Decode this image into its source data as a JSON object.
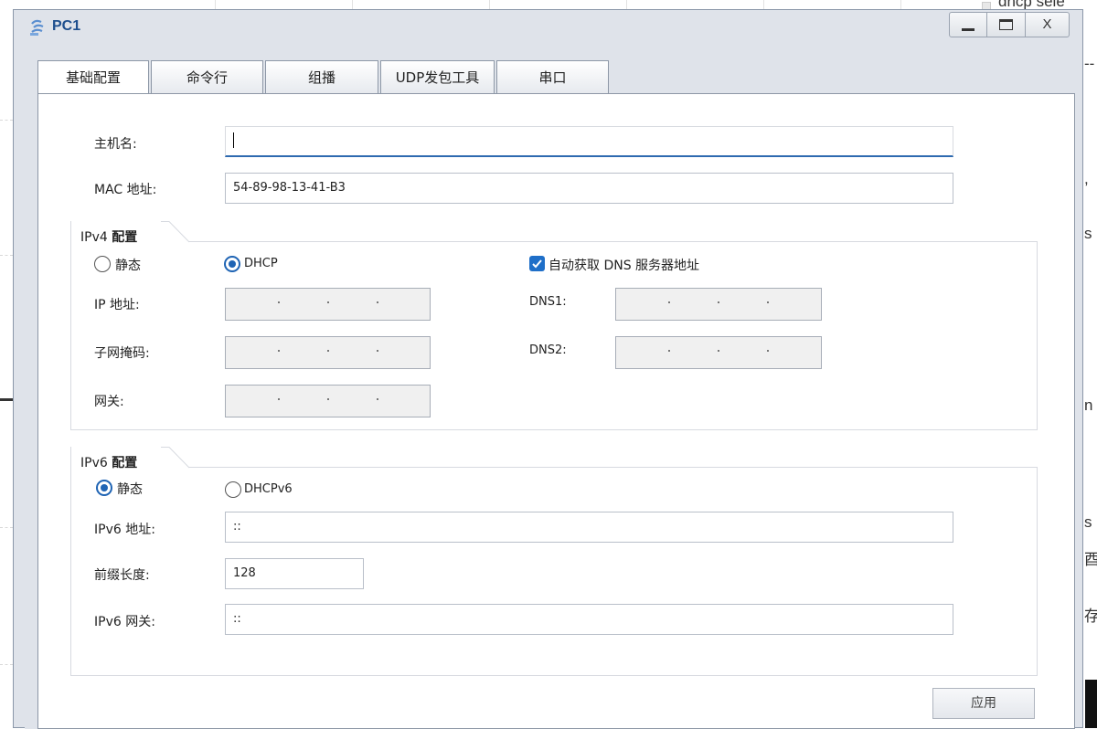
{
  "background": {
    "top_right_text": "dhcp sele",
    "right_fragments": [
      "--",
      ",",
      "s",
      "n",
      "s",
      "酉",
      "存"
    ]
  },
  "window": {
    "title": "PC1",
    "minimize_label": "_",
    "close_label": "X"
  },
  "tabs": [
    {
      "label": "基础配置",
      "active": true
    },
    {
      "label": "命令行",
      "active": false
    },
    {
      "label": "组播",
      "active": false
    },
    {
      "label": "UDP发包工具",
      "active": false
    },
    {
      "label": "串口",
      "active": false
    }
  ],
  "basic": {
    "hostname_label": "主机名:",
    "hostname_value": "",
    "mac_label": "MAC 地址:",
    "mac_value": "54-89-98-13-41-B3"
  },
  "ipv4": {
    "group_prefix": "IPv4 ",
    "group_suffix": "配置",
    "static_label": "静态",
    "dhcp_label": "DHCP",
    "selected": "DHCP",
    "auto_dns_label": "自动获取 DNS 服务器地址",
    "auto_dns_checked": true,
    "ip_label": "IP 地址:",
    "mask_label": "子网掩码:",
    "gateway_label": "网关:",
    "dns1_label": "DNS1:",
    "dns2_label": "DNS2:"
  },
  "ipv6": {
    "group_prefix": "IPv6 ",
    "group_suffix": "配置",
    "static_label": "静态",
    "dhcpv6_label": "DHCPv6",
    "selected": "静态",
    "address_label": "IPv6 地址:",
    "address_value": "::",
    "prefix_label": "前缀长度:",
    "prefix_value": "128",
    "gateway_label": "IPv6 网关:",
    "gateway_value": "::"
  },
  "actions": {
    "apply_label": "应用"
  }
}
